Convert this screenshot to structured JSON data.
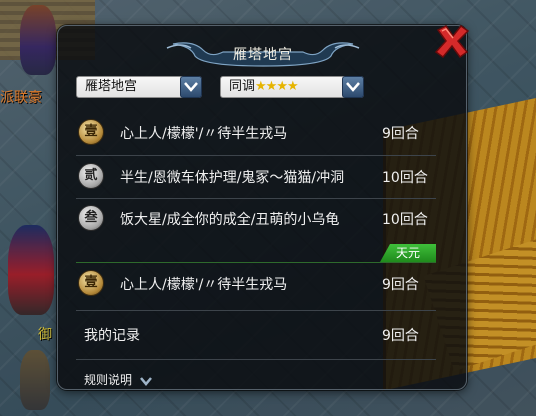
{
  "scene": {
    "player_name_1": "派联豪",
    "player_name_2": "御"
  },
  "panel": {
    "title": "雁塔地宫",
    "dungeon_select": {
      "value": "雁塔地宫"
    },
    "difficulty_select": {
      "value_prefix": "同调",
      "stars": "★★★★"
    },
    "rankings": [
      {
        "rank_glyph": "壹",
        "names": "心上人/檬檬'/〃待半生戎马",
        "rounds": "9回合"
      },
      {
        "rank_glyph": "贰",
        "names": "半生/恩微车体护理/鬼冢〜猫猫/冲洞",
        "rounds": "10回合"
      },
      {
        "rank_glyph": "叁",
        "names": "饭大星/成全你的成全/丑萌的小乌龟",
        "rounds": "10回合"
      }
    ],
    "server_tag": "天元",
    "server_best": {
      "rank_glyph": "壹",
      "names": "心上人/檬檬'/〃待半生戎马",
      "rounds": "9回合"
    },
    "my_record": {
      "label": "我的记录",
      "rounds": "9回合"
    },
    "rules_label": "规则说明"
  },
  "colors": {
    "accent_gold": "#e6b400",
    "tag_green": "#2fa82b",
    "close_red": "#d42a2a"
  },
  "icons": {
    "close": "close-x-icon",
    "dropdown": "chevron-down-icon"
  }
}
